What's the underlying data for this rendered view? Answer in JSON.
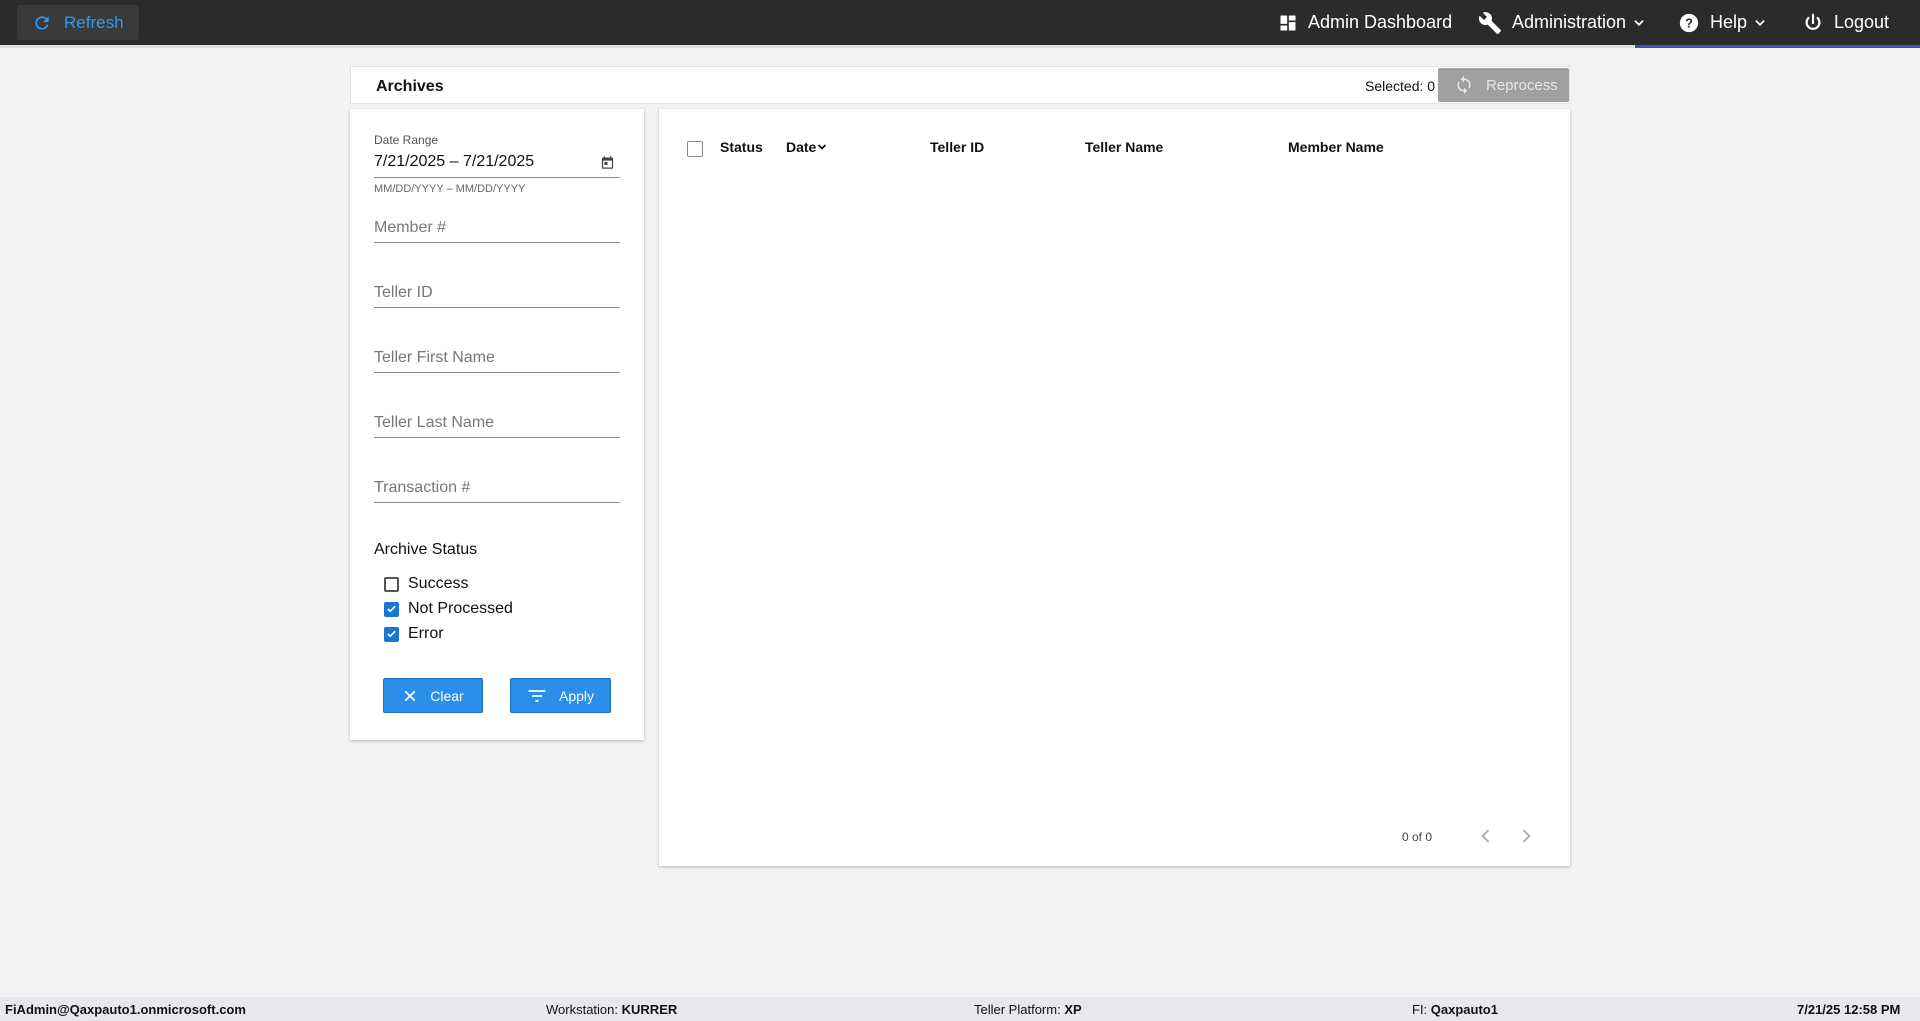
{
  "topbar": {
    "refresh_label": "Refresh",
    "admin_dashboard_label": "Admin Dashboard",
    "administration_label": "Administration",
    "help_label": "Help",
    "logout_label": "Logout",
    "accent_color": "#3f51b5",
    "refresh_color": "#2e9bf0"
  },
  "header": {
    "title": "Archives",
    "selected_label": "Selected: 0",
    "reprocess_label": "Reprocess"
  },
  "filters": {
    "date_range_label": "Date Range",
    "date_range_value": "7/21/2025 – 7/21/2025",
    "date_range_hint": "MM/DD/YYYY – MM/DD/YYYY",
    "member_placeholder": "Member #",
    "teller_id_placeholder": "Teller ID",
    "teller_first_placeholder": "Teller First Name",
    "teller_last_placeholder": "Teller Last Name",
    "transaction_placeholder": "Transaction #",
    "archive_status_label": "Archive Status",
    "statuses": [
      {
        "label": "Success",
        "checked": false
      },
      {
        "label": "Not Processed",
        "checked": true
      },
      {
        "label": "Error",
        "checked": true
      }
    ],
    "clear_label": "Clear",
    "apply_label": "Apply",
    "button_color": "#2b8ee8"
  },
  "grid": {
    "columns": [
      "Status",
      "Date",
      "Teller ID",
      "Teller Name",
      "Member Name"
    ],
    "rows": [],
    "pager_label": "0 of 0"
  },
  "footer": {
    "user": "FiAdmin@Qaxpauto1.onmicrosoft.com",
    "workstation_label": "Workstation:",
    "workstation_value": "KURRER",
    "platform_label": "Teller Platform:",
    "platform_value": "XP",
    "fi_label": "FI:",
    "fi_value": "Qaxpauto1",
    "datetime": "7/21/25 12:58 PM"
  }
}
